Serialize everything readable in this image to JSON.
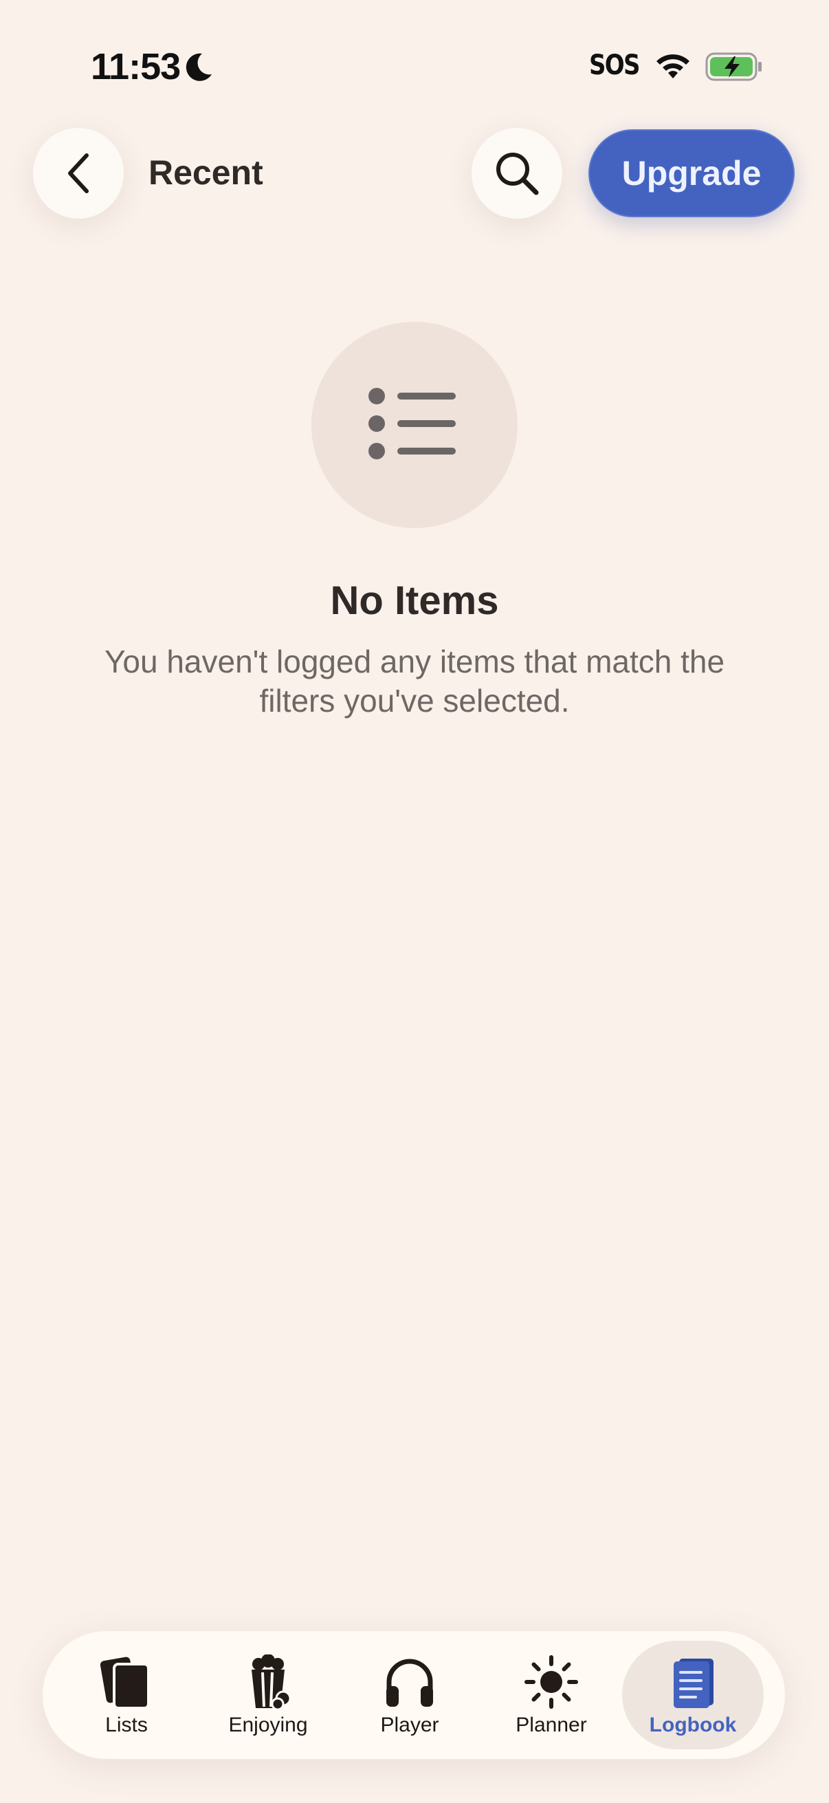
{
  "status_bar": {
    "time": "11:53",
    "sos": "SOS",
    "icons": [
      "moon-icon",
      "wifi-icon",
      "battery-charging-icon"
    ]
  },
  "header": {
    "title": "Recent",
    "upgrade_label": "Upgrade",
    "icons": [
      "chevron-left-icon",
      "search-icon"
    ]
  },
  "empty_state": {
    "icon": "list-bullet-icon",
    "title": "No Items",
    "message": "You haven't logged any items that match the filters you've selected."
  },
  "tab_bar": {
    "tabs": [
      {
        "label": "Lists",
        "icon": "cards-icon",
        "active": false
      },
      {
        "label": "Enjoying",
        "icon": "popcorn-icon",
        "active": false
      },
      {
        "label": "Player",
        "icon": "headphones-icon",
        "active": false
      },
      {
        "label": "Planner",
        "icon": "sun-icon",
        "active": false
      },
      {
        "label": "Logbook",
        "icon": "book-icon",
        "active": true
      }
    ]
  },
  "colors": {
    "background": "#faf1eb",
    "accent": "#4463c0",
    "battery": "#5dc05a"
  }
}
